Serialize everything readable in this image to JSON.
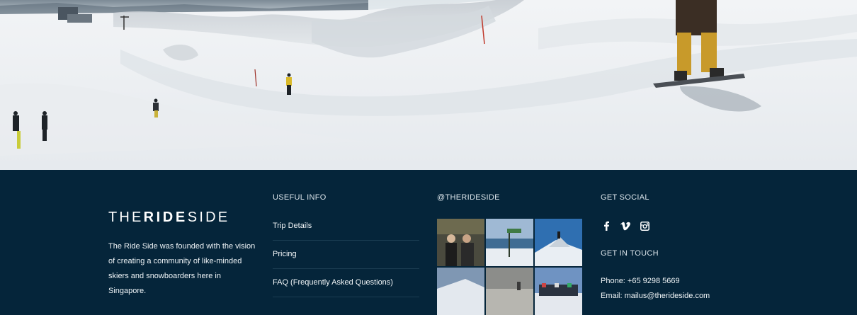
{
  "brand": {
    "part1": "THE",
    "part2": "RIDE",
    "part3": "SIDE"
  },
  "about": "The Ride Side was founded with the vision of creating a community of like-minded skiers and snowboarders here in Singapore.",
  "useful_info": {
    "title": "USEFUL INFO",
    "links": [
      "Trip Details",
      "Pricing",
      "FAQ (Frequently Asked Questions)"
    ]
  },
  "instagram": {
    "title": "@THERIDESIDE",
    "tiles": [
      "photo-people-shop",
      "photo-lake-signpost",
      "photo-mountain-summit",
      "photo-snowy-slope",
      "photo-foggy-rider",
      "photo-group-snow"
    ]
  },
  "social": {
    "title": "GET SOCIAL",
    "icons": [
      "facebook-icon",
      "vimeo-icon",
      "instagram-icon"
    ]
  },
  "contact": {
    "title": "GET IN TOUCH",
    "phone": "Phone: +65 9298 5669",
    "email": "Email: mailus@therideside.com"
  },
  "colors": {
    "footer_bg": "#05253a",
    "text": "#ffffff",
    "divider": "#1b3d52"
  }
}
